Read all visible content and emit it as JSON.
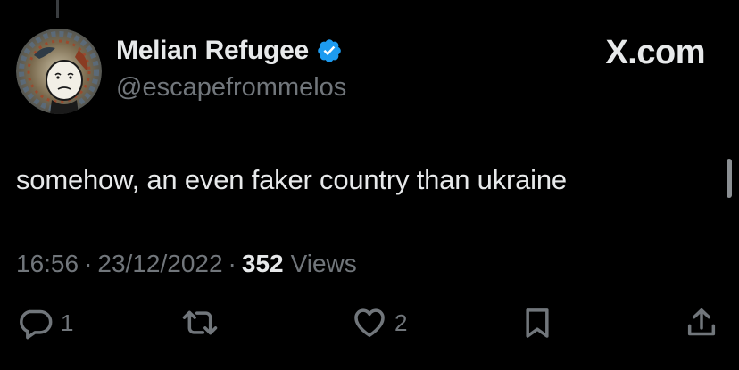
{
  "author": {
    "display_name": "Melian Refugee",
    "handle": "@escapefrommelos",
    "verified_icon": "verified-badge-icon",
    "verified_color": "#1d9bf0"
  },
  "brand": {
    "label": "X.com"
  },
  "tweet": {
    "text": "somehow, an even faker country than ukraine"
  },
  "meta": {
    "time": "16:56",
    "separator": "·",
    "date": "23/12/2022",
    "views_count": "352",
    "views_label": "Views"
  },
  "actions": {
    "reply": {
      "icon": "reply-icon",
      "count": "1"
    },
    "retweet": {
      "icon": "retweet-icon",
      "count": ""
    },
    "like": {
      "icon": "heart-icon",
      "count": "2"
    },
    "bookmark": {
      "icon": "bookmark-icon",
      "count": ""
    },
    "share": {
      "icon": "share-icon",
      "count": ""
    }
  },
  "colors": {
    "background": "#000000",
    "primary_text": "#e7e9ea",
    "secondary_text": "#71767b"
  }
}
